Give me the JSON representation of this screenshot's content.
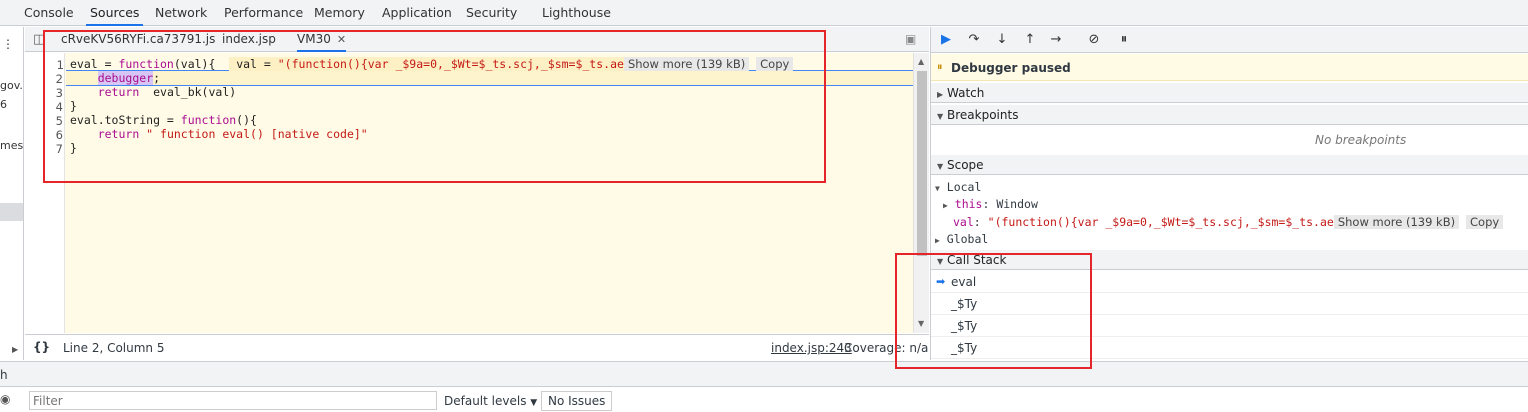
{
  "top_tabs": [
    "Console",
    "Sources",
    "Network",
    "Performance",
    "Memory",
    "Application",
    "Security",
    "Lighthouse"
  ],
  "left_pane_fragments": [
    "gov.c",
    "6",
    "mess"
  ],
  "editor_tabs": [
    "cRveKV56RYFi.ca73791.js",
    "index.jsp",
    "VM30"
  ],
  "code": {
    "line_numbers": [
      "1",
      "2",
      "3",
      "4",
      "5",
      "6",
      "7"
    ],
    "l1_prefix": "eval = ",
    "l1_kw": "function",
    "l1_rest": "(val){",
    "l1_inline_label": "val = ",
    "l1_inline_value": "\"(function(){var _$9a=0,_$Wt=$_ts.scj,_$sm=$_ts.ae",
    "l1_show_more": "Show more (139 kB)",
    "l1_copy": "Copy",
    "l2_hl": "debugger",
    "l2_rest": ";",
    "l3_kw": "return",
    "l3_rest": "  eval_bk(val)",
    "l4": "}",
    "l5_prefix": "eval.toString = ",
    "l5_kw": "function",
    "l5_rest": "(){",
    "l6_kw": "return",
    "l6_str": " \" function eval() [native code]\"",
    "l7": "}"
  },
  "editor_status": {
    "braces": "{}",
    "position": "Line 2, Column 5",
    "location_link": "index.jsp:243",
    "coverage": "Coverage: n/a"
  },
  "debugger": {
    "paused_label": "Debugger paused",
    "watch": "Watch",
    "breakpoints": "Breakpoints",
    "no_breakpoints": "No breakpoints",
    "scope": "Scope",
    "local": "Local",
    "this_key": "this",
    "this_val": "Window",
    "val_key": "val",
    "val_val": "\"(function(){var _$9a=0,_$Wt=$_ts.scj,_$sm=$_ts.ae",
    "show_more": "Show more (139 kB)",
    "copy": "Copy",
    "global": "Global",
    "call_stack": "Call Stack",
    "frames": [
      "eval",
      "_$Ty",
      "_$Ty",
      "_$Ty"
    ]
  },
  "drawer": {
    "tab_fragment": "h",
    "filter_placeholder": "Filter",
    "levels": "Default levels",
    "issues": "No Issues"
  },
  "colors": {
    "accent": "#1a73e8",
    "annotation_red": "#e5252a",
    "paused_bg": "#fffbe5",
    "editor_bg": "#fffbe6"
  }
}
